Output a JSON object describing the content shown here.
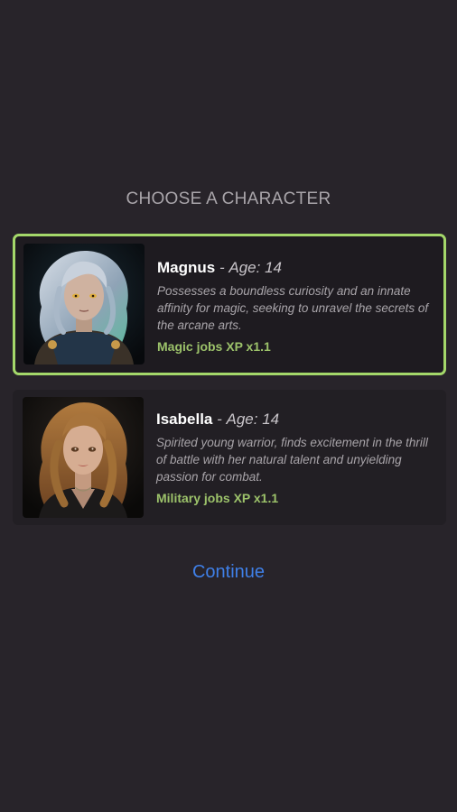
{
  "header": {
    "title": "CHOOSE A CHARACTER"
  },
  "characters": [
    {
      "name": "Magnus",
      "age_prefix": "-",
      "age": "Age: 14",
      "description": "Possesses a boundless curiosity and an innate affinity for magic, seeking to unravel the secrets of the arcane arts.",
      "bonus": "Magic jobs XP x1.1",
      "selected": true,
      "portrait_icon": "magus-portrait"
    },
    {
      "name": "Isabella",
      "age_prefix": "-",
      "age": "Age: 14",
      "description": "Spirited young warrior, finds excitement in the thrill of battle with her natural talent and unyielding passion for combat.",
      "bonus": "Military jobs XP x1.1",
      "selected": false,
      "portrait_icon": "warrior-portrait"
    }
  ],
  "actions": {
    "continue_label": "Continue"
  },
  "colors": {
    "background": "#28242a",
    "selected_border": "#a4d86a",
    "bonus_text": "#9cc26a",
    "continue_link": "#3f80e8"
  }
}
